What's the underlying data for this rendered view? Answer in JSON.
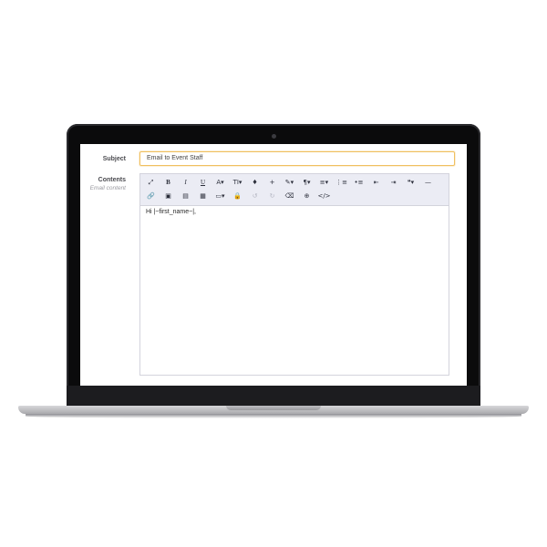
{
  "form": {
    "subject_label": "Subject",
    "subject_value": "Email to Event Staff",
    "contents_label": "Contents",
    "contents_sublabel": "Email content"
  },
  "toolbar": {
    "row1": [
      {
        "name": "fullscreen-icon",
        "glyph": "⤢"
      },
      {
        "name": "bold-icon",
        "glyph": "B"
      },
      {
        "name": "italic-icon",
        "glyph": "I"
      },
      {
        "name": "underline-icon",
        "glyph": "U"
      },
      {
        "name": "font-color-icon",
        "glyph": "A▾"
      },
      {
        "name": "font-size-icon",
        "glyph": "TI▾"
      },
      {
        "name": "highlight-icon",
        "glyph": "♦"
      },
      {
        "name": "add-icon",
        "glyph": "+"
      },
      {
        "name": "magic-style-icon",
        "glyph": "✎▾"
      },
      {
        "name": "paragraph-icon",
        "glyph": "¶▾"
      },
      {
        "name": "align-icon",
        "glyph": "≡▾"
      },
      {
        "name": "ordered-list-icon",
        "glyph": "⋮≡"
      },
      {
        "name": "unordered-list-icon",
        "glyph": "•≡"
      },
      {
        "name": "outdent-icon",
        "glyph": "⇤"
      },
      {
        "name": "indent-icon",
        "glyph": "⇥"
      },
      {
        "name": "quote-icon",
        "glyph": "❝▾"
      },
      {
        "name": "horizontal-rule-icon",
        "glyph": "—"
      }
    ],
    "row2": [
      {
        "name": "link-icon",
        "glyph": "🔗"
      },
      {
        "name": "image-icon",
        "glyph": "▣"
      },
      {
        "name": "file-icon",
        "glyph": "▤"
      },
      {
        "name": "table-icon",
        "glyph": "▦"
      },
      {
        "name": "video-icon",
        "glyph": "▭▾"
      },
      {
        "name": "lock-icon",
        "glyph": "🔒"
      },
      {
        "name": "undo-icon",
        "glyph": "↺"
      },
      {
        "name": "redo-icon",
        "glyph": "↻"
      },
      {
        "name": "clear-format-icon",
        "glyph": "⌫"
      },
      {
        "name": "special-chars-icon",
        "glyph": "⊕"
      },
      {
        "name": "code-view-icon",
        "glyph": "</>"
      }
    ]
  },
  "editor": {
    "content": "Hi |~first_name~|,"
  }
}
